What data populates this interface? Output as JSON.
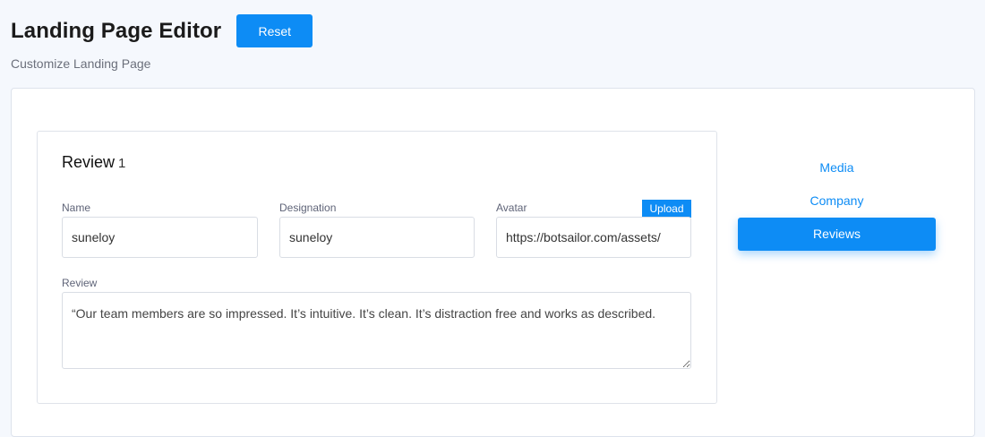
{
  "header": {
    "title": "Landing Page Editor",
    "reset_label": "Reset",
    "subtitle": "Customize Landing Page"
  },
  "review": {
    "heading": "Review",
    "index": "1",
    "name_label": "Name",
    "name_value": "suneloy",
    "designation_label": "Designation",
    "designation_value": "suneloy",
    "avatar_label": "Avatar",
    "avatar_value": "https://botsailor.com/assets/",
    "upload_label": "Upload",
    "review_label": "Review",
    "review_value": "“Our team members are so impressed. It’s intuitive. It’s clean. It’s distraction free and works as described."
  },
  "tabs": [
    {
      "label": "Media",
      "active": false
    },
    {
      "label": "Company",
      "active": false
    },
    {
      "label": "Reviews",
      "active": true
    }
  ],
  "colors": {
    "accent": "#0d8cf5",
    "page_background": "#f5f8fd"
  }
}
